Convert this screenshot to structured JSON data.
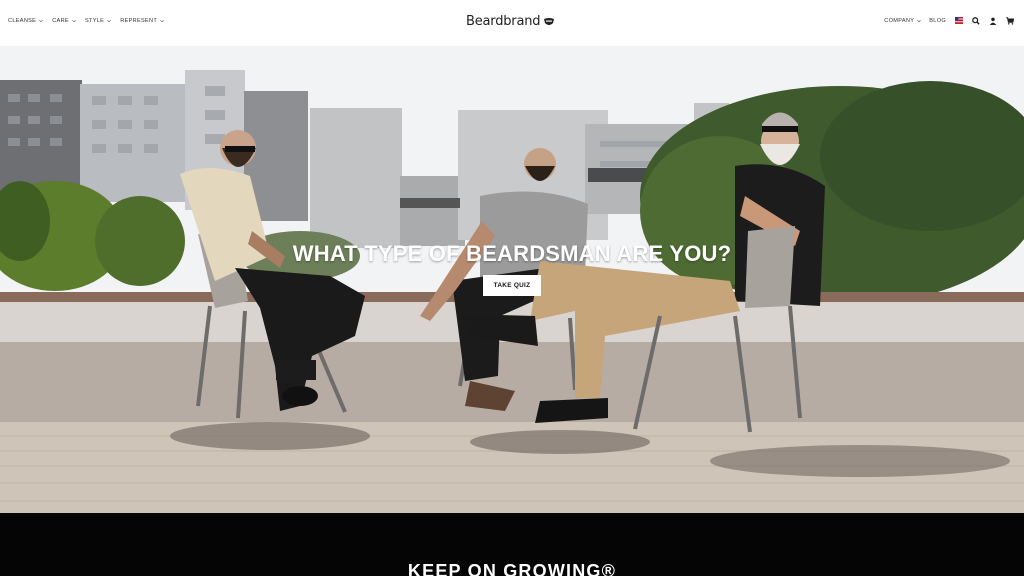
{
  "brand": {
    "name": "Beardbrand"
  },
  "nav_left": [
    {
      "label": "CLEANSE"
    },
    {
      "label": "CARE"
    },
    {
      "label": "STYLE"
    },
    {
      "label": "REPRESENT"
    }
  ],
  "nav_right": {
    "company": "COMPANY",
    "blog": "BLOG",
    "icons": [
      "flag-icon",
      "search-icon",
      "account-icon",
      "cart-icon"
    ]
  },
  "hero": {
    "title": "WHAT TYPE OF BEARDSMAN ARE YOU?",
    "button": "TAKE QUIZ"
  },
  "band": {
    "title": "KEEP ON GROWING®"
  },
  "colors": {
    "header_bg": "#ffffff",
    "band_bg": "#050505",
    "button_bg": "#ffffff"
  }
}
